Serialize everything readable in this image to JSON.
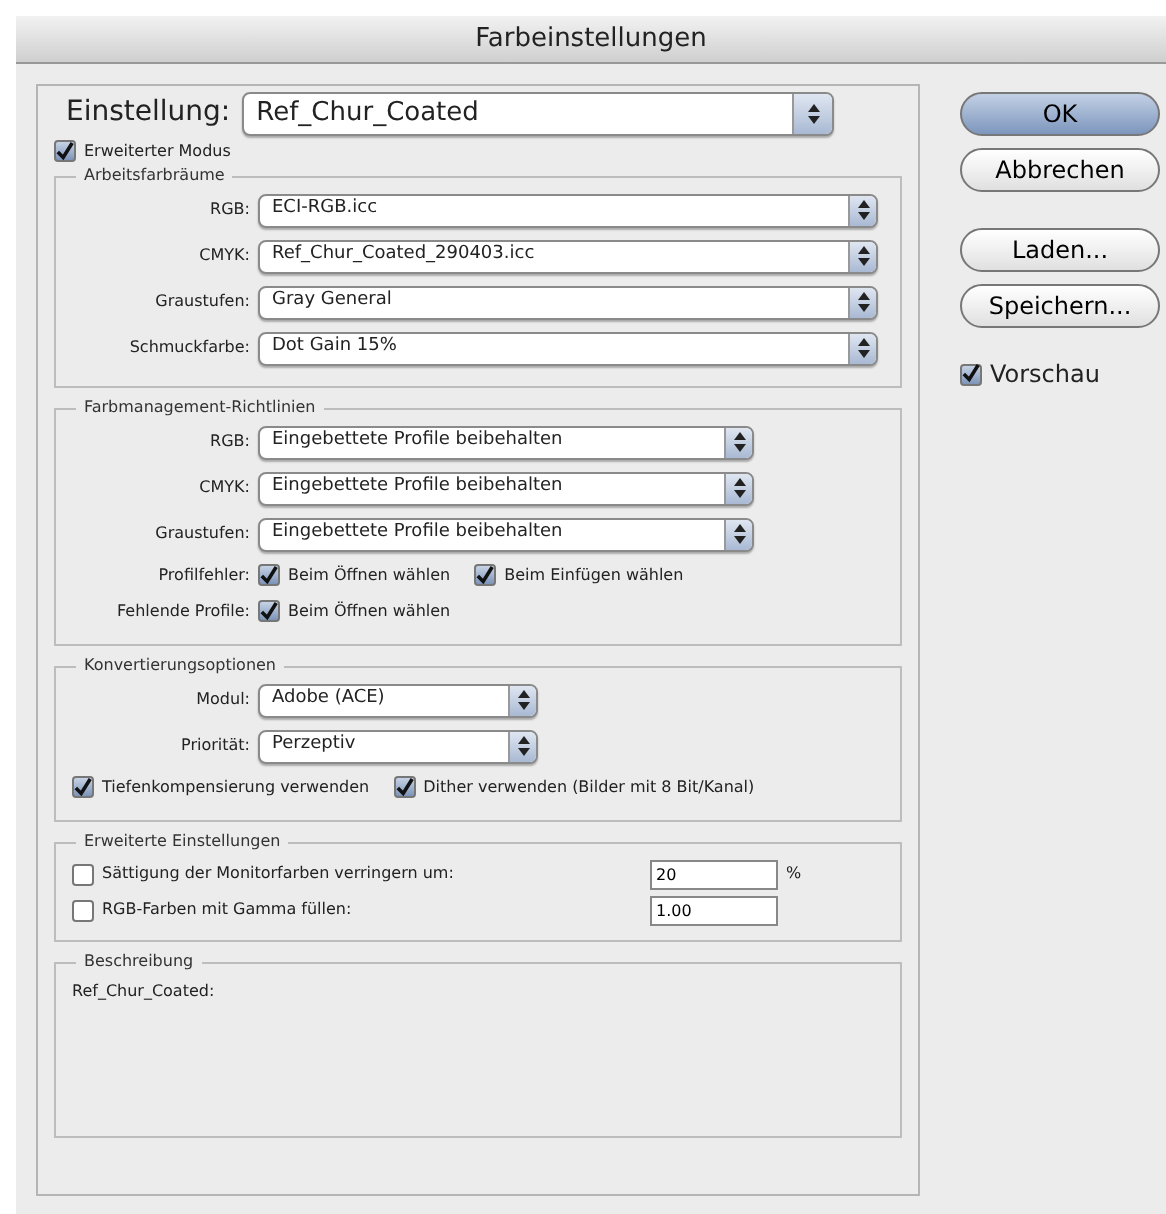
{
  "window": {
    "title": "Farbeinstellungen"
  },
  "setting": {
    "label": "Einstellung:",
    "value": "Ref_Chur_Coated"
  },
  "advanced_mode": {
    "label": "Erweiterter Modus",
    "checked": true
  },
  "sections": [
    {
      "kind": "profiles",
      "title": "Arbeitsfarbräume",
      "rows": [
        {
          "kind": "select",
          "label": "RGB:",
          "value": "ECI-RGB.icc"
        },
        {
          "kind": "select",
          "label": "CMYK:",
          "value": "Ref_Chur_Coated_290403.icc"
        },
        {
          "kind": "select",
          "label": "Graustufen:",
          "value": "Gray General"
        },
        {
          "kind": "select",
          "label": "Schmuckfarbe:",
          "value": "Dot Gain 15%"
        }
      ]
    },
    {
      "kind": "policies",
      "title": "Farbmanagement-Richtlinien",
      "rows": [
        {
          "kind": "select",
          "label": "RGB:",
          "value": "Eingebettete Profile beibehalten"
        },
        {
          "kind": "select",
          "label": "CMYK:",
          "value": "Eingebettete Profile beibehalten"
        },
        {
          "kind": "select",
          "label": "Graustufen:",
          "value": "Eingebettete Profile beibehalten"
        },
        {
          "kind": "checks",
          "label": "Profilfehler:",
          "options": [
            {
              "label": "Beim Öffnen wählen",
              "checked": true
            },
            {
              "label": "Beim Einfügen wählen",
              "checked": true
            }
          ]
        },
        {
          "kind": "checks",
          "label": "Fehlende Profile:",
          "options": [
            {
              "label": "Beim Öffnen wählen",
              "checked": true
            }
          ]
        }
      ]
    },
    {
      "kind": "conversion",
      "title": "Konvertierungsoptionen",
      "rows": [
        {
          "kind": "select",
          "label": "Modul:",
          "value": "Adobe (ACE)"
        },
        {
          "kind": "select",
          "label": "Priorität:",
          "value": "Perzeptiv"
        },
        {
          "kind": "checks",
          "options": [
            {
              "label": "Tiefenkompensierung verwenden",
              "checked": true
            },
            {
              "label": "Dither verwenden (Bilder mit 8 Bit/Kanal)",
              "checked": true
            }
          ]
        }
      ]
    },
    {
      "kind": "advanced",
      "title": "Erweiterte Einstellungen",
      "rows": [
        {
          "kind": "field",
          "label": "Sättigung der Monitorfarben verringern um:",
          "checked": false,
          "value": "20",
          "unit": "%"
        },
        {
          "kind": "field",
          "label": "RGB-Farben mit Gamma füllen:",
          "checked": false,
          "value": "1.00"
        }
      ]
    },
    {
      "kind": "description",
      "title": "Beschreibung",
      "rows": [
        {
          "kind": "text",
          "text": "Ref_Chur_Coated:"
        }
      ]
    }
  ],
  "buttons": [
    {
      "label": "OK",
      "kind": "default"
    },
    {
      "label": "Abbrechen",
      "kind": "normal"
    },
    {
      "label": "Laden...",
      "kind": "spaced"
    },
    {
      "label": "Speichern...",
      "kind": "normal"
    }
  ],
  "preview": {
    "label": "Vorschau",
    "checked": true
  }
}
